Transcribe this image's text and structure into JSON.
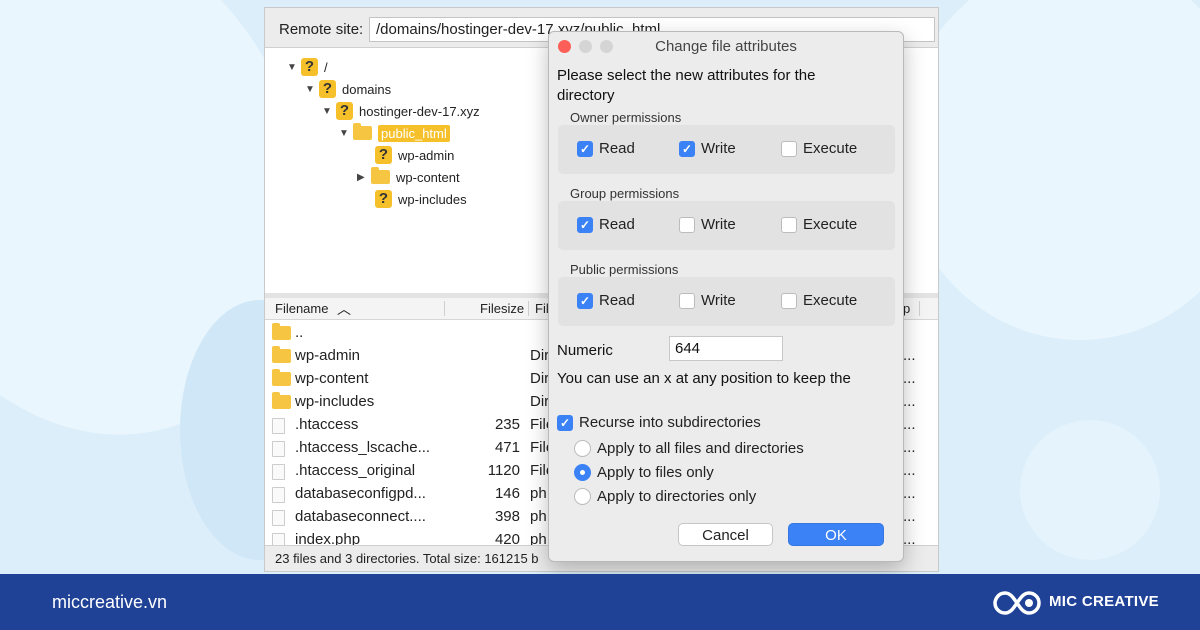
{
  "site_bar": {
    "label": "Remote site:",
    "path": "/domains/hostinger-dev-17.xyz/public_html"
  },
  "tree": {
    "root": "/",
    "domains": "domains",
    "host": "hostinger-dev-17.xyz",
    "public_html": "public_html",
    "wp_admin": "wp-admin",
    "wp_content": "wp-content",
    "wp_includes": "wp-includes"
  },
  "list": {
    "headers": {
      "filename": "Filename",
      "filesize": "Filesize",
      "filetype": "Fil",
      "perm": "p"
    },
    "rows": [
      {
        "name": "..",
        "size": "",
        "type": "",
        "perm": ""
      },
      {
        "name": "wp-admin",
        "size": "",
        "type": "Dir",
        "perm": "..."
      },
      {
        "name": "wp-content",
        "size": "",
        "type": "Dir",
        "perm": "..."
      },
      {
        "name": "wp-includes",
        "size": "",
        "type": "Dir",
        "perm": "..."
      },
      {
        "name": ".htaccess",
        "size": "235",
        "type": "File",
        "perm": "..."
      },
      {
        "name": ".htaccess_lscache...",
        "size": "471",
        "type": "File",
        "perm": "..."
      },
      {
        "name": ".htaccess_original",
        "size": "1120",
        "type": "File",
        "perm": "..."
      },
      {
        "name": "databaseconfigpd...",
        "size": "146",
        "type": "ph",
        "perm": "..."
      },
      {
        "name": "databaseconnect....",
        "size": "398",
        "type": "ph",
        "perm": "..."
      },
      {
        "name": "index.php",
        "size": "420",
        "type": "ph",
        "perm": "..."
      }
    ],
    "status": "23 files and 3 directories. Total size: 161215 b"
  },
  "dialog": {
    "title": "Change file attributes",
    "intro": "Please select the new attributes for the directory",
    "owner_label": "Owner permissions",
    "group_label": "Group permissions",
    "public_label": "Public permissions",
    "read": "Read",
    "write": "Write",
    "execute": "Execute",
    "owner": {
      "read": true,
      "write": true,
      "execute": false
    },
    "group": {
      "read": true,
      "write": false,
      "execute": false
    },
    "public": {
      "read": true,
      "write": false,
      "execute": false
    },
    "numeric_label": "Numeric",
    "numeric_value": "644",
    "hint": "You can use an x at any position to keep the",
    "recurse_label": "Recurse into subdirectories",
    "recurse": true,
    "radio_all": "Apply to all files and directories",
    "radio_files": "Apply to files only",
    "radio_dirs": "Apply to directories only",
    "selected_radio": "files",
    "cancel": "Cancel",
    "ok": "OK"
  },
  "footer": {
    "site": "miccreative.vn",
    "brand": "MIC CREATIVE"
  },
  "colors": {
    "accent": "#3b82f6",
    "footer_bg": "#1f4196",
    "folder": "#f6c643"
  }
}
